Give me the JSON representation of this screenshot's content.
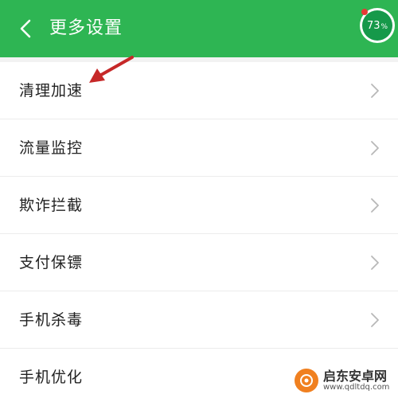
{
  "header": {
    "title": "更多设置",
    "back_icon": "chevron-left-icon",
    "battery": {
      "value": "73",
      "unit": "%"
    }
  },
  "menu": {
    "items": [
      {
        "label": "清理加速",
        "icon": "chevron-right-icon"
      },
      {
        "label": "流量监控",
        "icon": "chevron-right-icon"
      },
      {
        "label": "欺诈拦截",
        "icon": "chevron-right-icon"
      },
      {
        "label": "支付保镖",
        "icon": "chevron-right-icon"
      },
      {
        "label": "手机杀毒",
        "icon": "chevron-right-icon"
      },
      {
        "label": "手机优化",
        "icon": "chevron-right-icon"
      }
    ]
  },
  "watermark": {
    "name": "启东安卓网",
    "url": "www.qdltdq.com"
  },
  "colors": {
    "header_bg": "#2eb553",
    "battery_bg": "#16994a",
    "annotation_arrow": "#c62828",
    "text_primary": "#222222",
    "chevron": "#b8b8b8"
  }
}
